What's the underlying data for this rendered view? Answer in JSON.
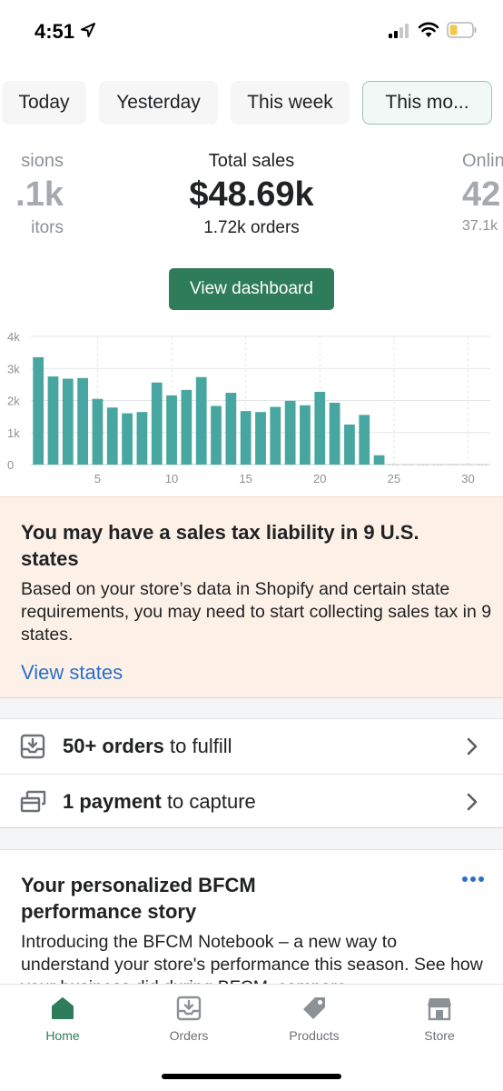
{
  "status_bar": {
    "time": "4:51"
  },
  "chips": [
    {
      "label": "Today",
      "active": false
    },
    {
      "label": "Yesterday",
      "active": false
    },
    {
      "label": "This week",
      "active": false
    },
    {
      "label": "This mo...",
      "active": true
    }
  ],
  "metrics": {
    "left": {
      "label": "sions",
      "value": ".1k",
      "sub": "itors"
    },
    "center": {
      "label": "Total sales",
      "value": "$48.69k",
      "sub": "1.72k orders"
    },
    "right": {
      "label": "Onlin",
      "value": "42",
      "sub": "37.1k"
    }
  },
  "view_dashboard_label": "View dashboard",
  "chart_data": {
    "type": "bar",
    "ylim": [
      0,
      4000
    ],
    "y_ticks": [
      {
        "v": 0,
        "label": "0"
      },
      {
        "v": 1000,
        "label": "1k"
      },
      {
        "v": 2000,
        "label": "2k"
      },
      {
        "v": 3000,
        "label": "3k"
      },
      {
        "v": 4000,
        "label": "4k"
      }
    ],
    "x_ticks": [
      5,
      10,
      15,
      20,
      25,
      30
    ],
    "x_range": [
      1,
      31
    ],
    "days": [
      1,
      2,
      3,
      4,
      5,
      6,
      7,
      8,
      9,
      10,
      11,
      12,
      13,
      14,
      15,
      16,
      17,
      18,
      19,
      20,
      21,
      22,
      23,
      24
    ],
    "values": [
      3350,
      2750,
      2680,
      2700,
      2050,
      1780,
      1600,
      1640,
      2560,
      2160,
      2330,
      2730,
      1830,
      2240,
      1670,
      1640,
      1800,
      1990,
      1850,
      2270,
      1930,
      1250,
      1550,
      290
    ],
    "bar_color": "#47a6a0"
  },
  "tax_banner": {
    "title": "You may have a sales tax liability in 9 U.S. states",
    "body": "Based on your store’s data in Shopify and certain state requirements, you may need to start collecting sales tax in 9 states.",
    "link": "View states"
  },
  "tasks": [
    {
      "bold": "50+ orders",
      "rest": " to fulfill"
    },
    {
      "bold": "1 payment",
      "rest": " to capture"
    }
  ],
  "story": {
    "title": "Your personalized BFCM performance story",
    "body": "Introducing the BFCM Notebook – a new way to understand your store's performance this season. See how your business did during BFCM, compare"
  },
  "tabs": [
    {
      "label": "Home",
      "icon": "home-icon",
      "active": true
    },
    {
      "label": "Orders",
      "icon": "orders-icon",
      "active": false
    },
    {
      "label": "Products",
      "icon": "products-icon",
      "active": false
    },
    {
      "label": "Store",
      "icon": "store-icon",
      "active": false
    }
  ],
  "colors": {
    "accent": "#2f7c5a",
    "link": "#2c6ecb",
    "banner_bg": "#fdf1e7"
  }
}
